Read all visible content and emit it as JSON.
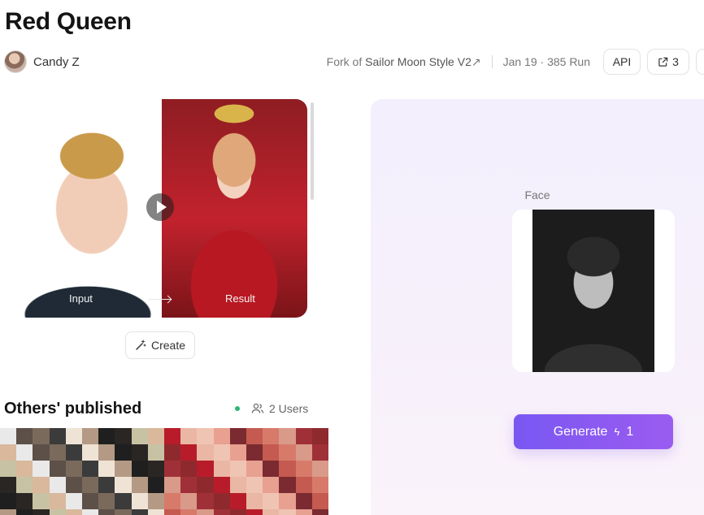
{
  "header": {
    "title": "Red Queen",
    "author": "Candy Z",
    "fork_prefix": "Fork of",
    "fork_source": "Sailor Moon Style V2",
    "fork_arrow": "↗",
    "date_runs": "Jan 19 · 385 Run",
    "api_label": "API",
    "share_count": "3"
  },
  "preview": {
    "input_label": "Input",
    "result_label": "Result"
  },
  "create_label": "Create",
  "others": {
    "title": "Others' published",
    "users": "2 Users"
  },
  "panel": {
    "face_label": "Face",
    "generate_label": "Generate",
    "credits": "1"
  },
  "colors": {
    "accent": "#7a57f2",
    "online": "#2bb673"
  },
  "icons": {
    "share": "share-icon",
    "magic": "magic-wand-icon",
    "users": "users-icon",
    "bolt": "bolt-icon",
    "play": "play-icon"
  }
}
